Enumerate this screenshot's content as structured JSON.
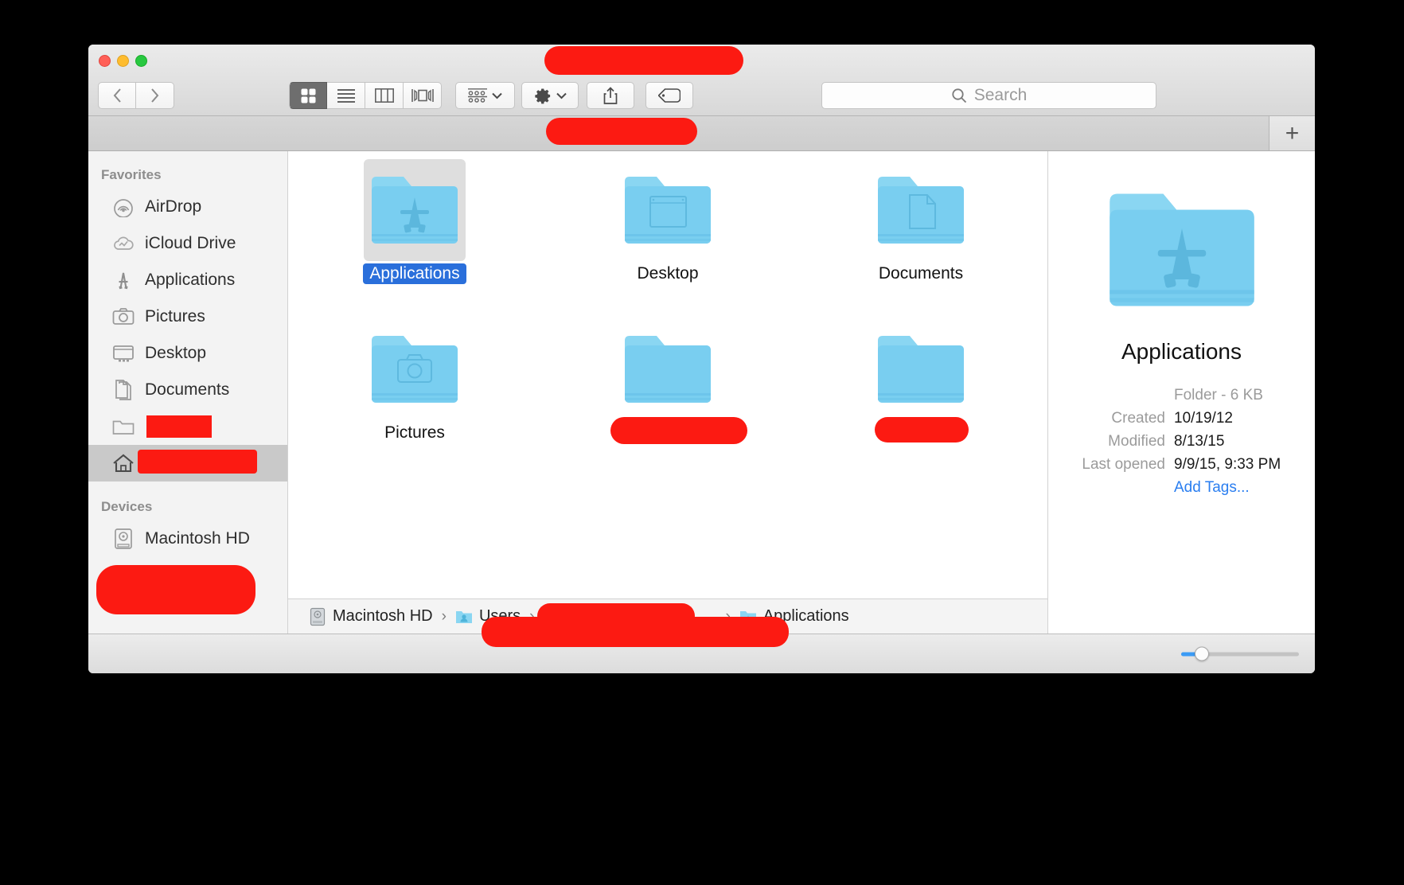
{
  "window": {
    "traffic_lights": [
      "close",
      "minimize",
      "maximize"
    ],
    "back_label": "Back",
    "forward_label": "Forward"
  },
  "toolbar": {
    "view_modes": [
      {
        "name": "icon-view",
        "label": "Icon View",
        "active": true
      },
      {
        "name": "list-view",
        "label": "List View",
        "active": false
      },
      {
        "name": "column-view",
        "label": "Column View",
        "active": false
      },
      {
        "name": "coverflow-view",
        "label": "Cover Flow View",
        "active": false
      }
    ],
    "arrange_label": "Arrange By",
    "action_label": "Action",
    "share_label": "Share",
    "tags_label": "Edit Tags"
  },
  "search": {
    "placeholder": "Search",
    "value": ""
  },
  "tabbar": {
    "new_tab_label": "+"
  },
  "sidebar": {
    "sections": [
      {
        "header": "Favorites",
        "items": [
          {
            "label": "AirDrop",
            "icon": "airdrop-icon",
            "selected": false,
            "redacted": false
          },
          {
            "label": "iCloud Drive",
            "icon": "icloud-icon",
            "selected": false,
            "redacted": false
          },
          {
            "label": "Applications",
            "icon": "applications-icon",
            "selected": false,
            "redacted": false
          },
          {
            "label": "Pictures",
            "icon": "pictures-icon",
            "selected": false,
            "redacted": false
          },
          {
            "label": "Desktop",
            "icon": "desktop-icon",
            "selected": false,
            "redacted": false
          },
          {
            "label": "Documents",
            "icon": "documents-icon",
            "selected": false,
            "redacted": false
          },
          {
            "label": "",
            "icon": "folder-icon",
            "selected": false,
            "redacted": true
          },
          {
            "label": "",
            "icon": "home-icon",
            "selected": true,
            "redacted": true
          }
        ]
      },
      {
        "header": "Devices",
        "items": [
          {
            "label": "Macintosh HD",
            "icon": "harddisk-icon",
            "selected": false,
            "redacted": false
          }
        ]
      }
    ]
  },
  "main": {
    "items": [
      {
        "label": "Applications",
        "icon": "folder-applications-icon",
        "selected": true,
        "redacted": false
      },
      {
        "label": "Desktop",
        "icon": "folder-desktop-icon",
        "selected": false,
        "redacted": false
      },
      {
        "label": "Documents",
        "icon": "folder-documents-icon",
        "selected": false,
        "redacted": false
      },
      {
        "label": "Pictures",
        "icon": "folder-pictures-icon",
        "selected": false,
        "redacted": false
      },
      {
        "label": "",
        "icon": "folder-plain-icon",
        "selected": false,
        "redacted": true
      },
      {
        "label": "",
        "icon": "folder-plain-icon",
        "selected": false,
        "redacted": true
      }
    ]
  },
  "pathbar": {
    "segments": [
      {
        "label": "Macintosh HD",
        "icon": "harddisk-icon",
        "redacted": false
      },
      {
        "label": "Users",
        "icon": "users-folder-icon",
        "redacted": false
      },
      {
        "label": "",
        "icon": "home-folder-icon",
        "redacted": true
      },
      {
        "label": "Applications",
        "icon": "applications-folder-icon",
        "redacted": false
      }
    ],
    "separator": "›"
  },
  "info_panel": {
    "title": "Applications",
    "kind_and_size": "Folder - 6 KB",
    "rows": [
      {
        "key": "Created",
        "value": "10/19/12"
      },
      {
        "key": "Modified",
        "value": "8/13/15"
      },
      {
        "key": "Last opened",
        "value": "9/9/15, 9:33 PM"
      }
    ],
    "add_tags_label": "Add Tags..."
  },
  "statusbar": {
    "zoom_level": 18
  },
  "colors": {
    "selection_blue": "#2a6fdb",
    "link_blue": "#2a7ef0",
    "redaction_red": "#fc1a12",
    "folder_blue": "#74cdf0",
    "slider_blue": "#3b9bf5"
  }
}
